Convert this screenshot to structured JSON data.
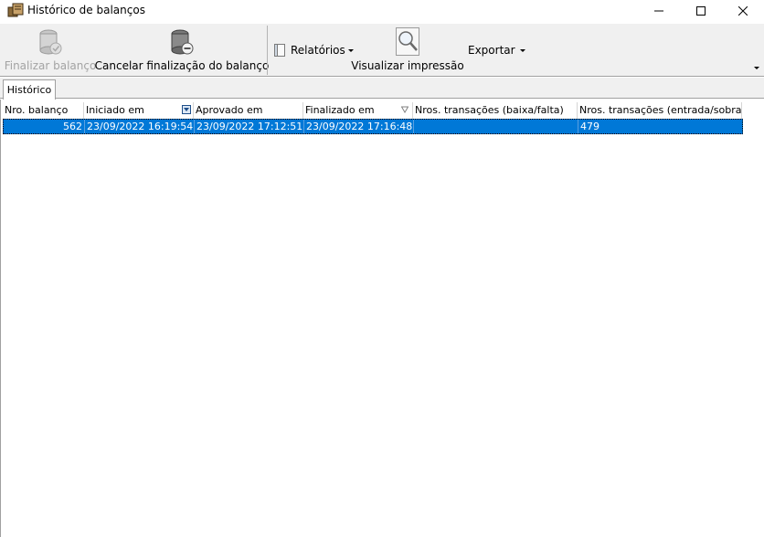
{
  "window": {
    "title": "Histórico de balanços"
  },
  "toolbar": {
    "finalizar_label": "Finalizar balanço",
    "cancelar_label": "Cancelar finalização do balanço",
    "relatorios_label": "Relatórios",
    "visualizar_label": "Visualizar impressão",
    "exportar_label": "Exportar"
  },
  "tabs": [
    {
      "label": "Histórico"
    }
  ],
  "grid": {
    "columns": [
      "Nro. balanço",
      "Iniciado em",
      "Aprovado em",
      "Finalizado em",
      "Nros. transações (baixa/falta)",
      "Nros. transações (entrada/sobra)"
    ],
    "rows": [
      [
        "562",
        "23/09/2022 16:19:54",
        "23/09/2022 17:12:51",
        "23/09/2022 17:16:48",
        "",
        "479"
      ]
    ]
  },
  "colors": {
    "selection": "#0078d7",
    "toolbar_bg": "#f0f0f0",
    "disabled_text": "#a3a3a3"
  }
}
